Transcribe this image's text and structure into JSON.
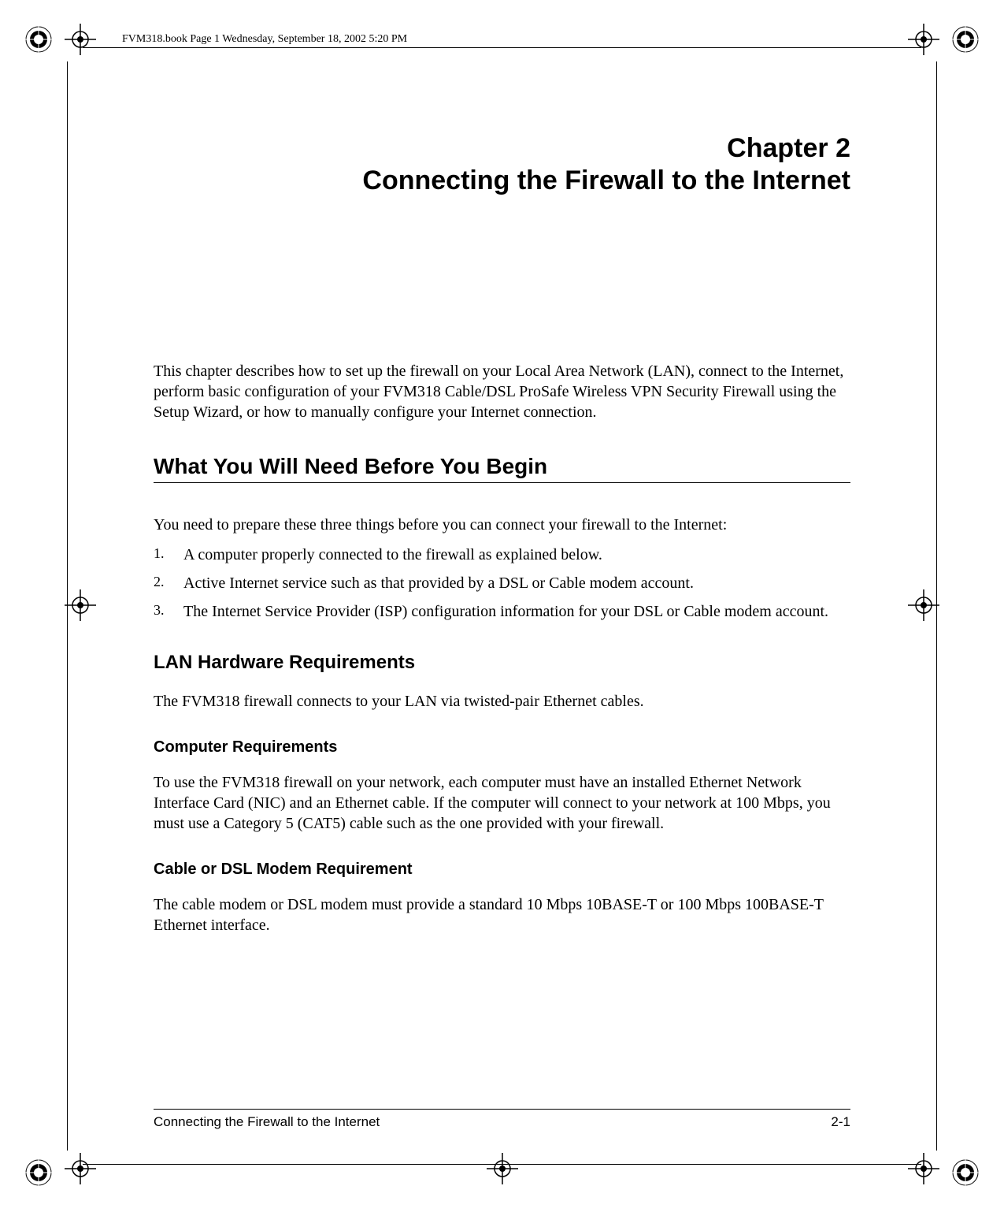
{
  "header": {
    "book_info": "FVM318.book  Page 1  Wednesday, September 18, 2002  5:20 PM"
  },
  "chapter": {
    "number": "Chapter 2",
    "title": "Connecting the Firewall to the Internet"
  },
  "intro": "This chapter describes how to set up the firewall on your Local Area Network (LAN), connect to the Internet, perform basic configuration of your FVM318 Cable/DSL ProSafe Wireless VPN Security Firewall using the Setup Wizard, or how to manually configure your Internet connection.",
  "section1": {
    "heading": "What You Will Need Before You Begin",
    "body": "You need to prepare these three things before you can connect your firewall to the Internet:",
    "items": [
      "A computer properly connected to the firewall as explained below.",
      "Active Internet service such as that provided by a DSL or Cable modem account.",
      "The Internet Service Provider (ISP) configuration information for your DSL or Cable modem account."
    ],
    "numbers": [
      "1.",
      "2.",
      "3."
    ]
  },
  "subsection1": {
    "heading": "LAN Hardware Requirements",
    "body": "The FVM318 firewall connects to your LAN via twisted-pair Ethernet cables."
  },
  "subsub1": {
    "heading": "Computer Requirements",
    "body": "To use the FVM318 firewall on your network, each computer must have an installed Ethernet Network Interface Card (NIC) and an Ethernet cable. If the computer will connect to your network at 100 Mbps, you must use a Category 5 (CAT5) cable such as the one provided with your firewall."
  },
  "subsub2": {
    "heading": "Cable or DSL Modem Requirement",
    "body": "The cable modem or DSL modem must provide a standard 10 Mbps 10BASE-T or 100 Mbps 100BASE-T Ethernet interface."
  },
  "footer": {
    "left": "Connecting the Firewall to the Internet",
    "right": "2-1"
  }
}
